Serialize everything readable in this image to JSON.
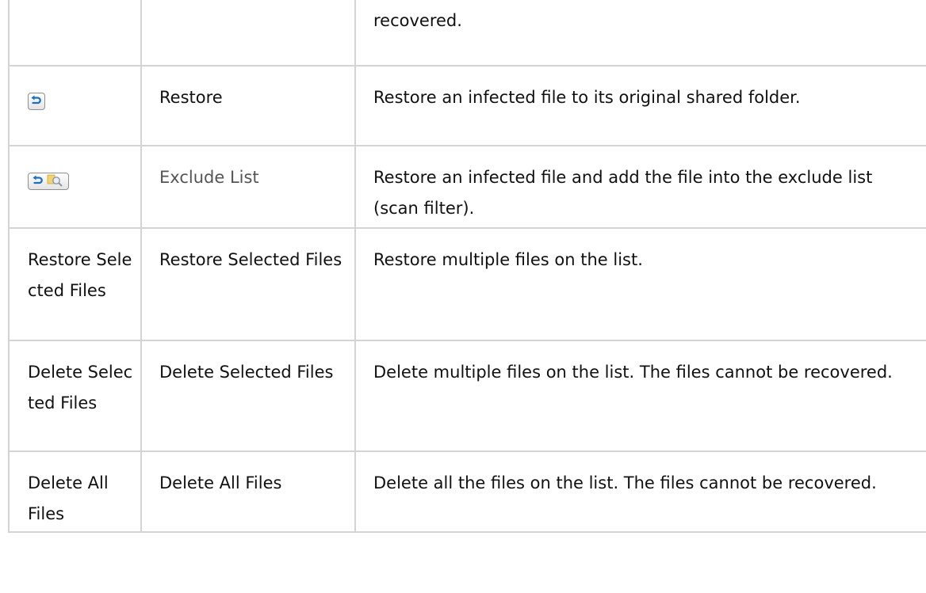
{
  "table": {
    "rows": [
      {
        "icon": "",
        "label": "",
        "description": "recovered."
      },
      {
        "icon": "restore-icon",
        "label": "Restore",
        "description": "Restore an infected file to its original shared folder."
      },
      {
        "icon": "restore-exclude-icon",
        "label": "Exclude List",
        "description": "Restore an infected file and add the file into the exclude list (scan filter)."
      },
      {
        "button": "Restore Selected Files",
        "label": "Restore Selected Files",
        "description": "Restore multiple files on the list."
      },
      {
        "button": "Delete Selected Files",
        "label": "Delete Selected Files",
        "description": "Delete multiple files on the list. The files cannot be recovered."
      },
      {
        "button": "Delete All Files",
        "label": "Delete All Files",
        "description": "Delete all the files on the list. The files cannot be recovered."
      }
    ]
  },
  "colors": {
    "border": "#d4d4d4",
    "text": "#111111",
    "icon_blue": "#1a6fc4"
  }
}
